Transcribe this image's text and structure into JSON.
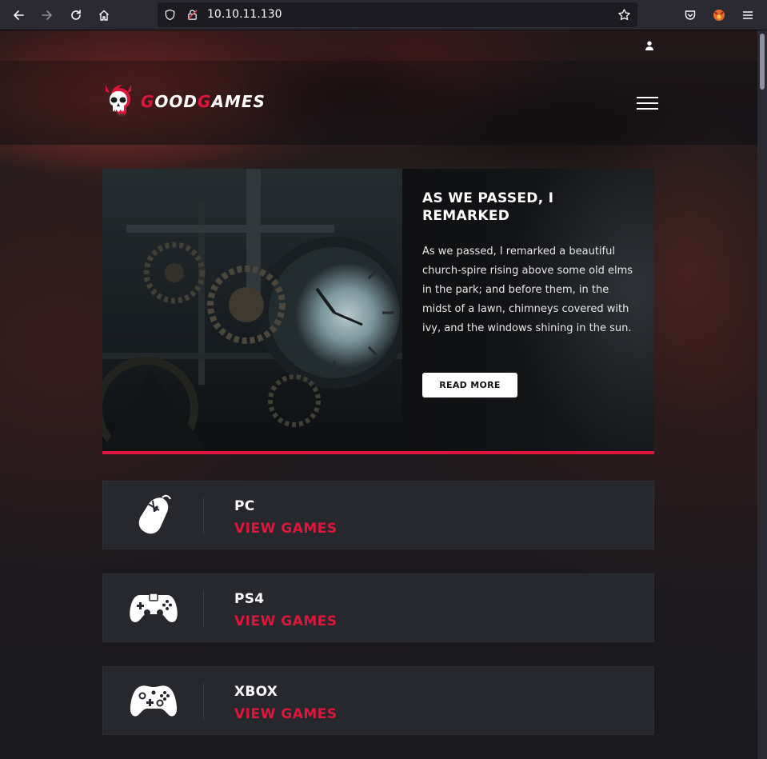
{
  "browser": {
    "url": "10.10.11.130"
  },
  "site": {
    "logo": {
      "prefix": "G",
      "part1": "OOD",
      "mid": "G",
      "part2": "AMES"
    },
    "hero": {
      "title": "AS WE PASSED, I REMARKED",
      "text": "As we passed, I remarked a beautiful church-spire rising above some old elms in the park; and before them, in the midst of a lawn, chimneys covered with ivy, and the windows shining in the sun.",
      "button": "READ MORE"
    },
    "categories": [
      {
        "title": "PC",
        "link": "VIEW GAMES",
        "icon": "mouse-icon"
      },
      {
        "title": "PS4",
        "link": "VIEW GAMES",
        "icon": "ps4-controller-icon"
      },
      {
        "title": "XBOX",
        "link": "VIEW GAMES",
        "icon": "xbox-controller-icon"
      }
    ]
  },
  "colors": {
    "accent": "#dd163b",
    "card_bg": "#26282e",
    "browser_bg": "#2b2a33"
  }
}
